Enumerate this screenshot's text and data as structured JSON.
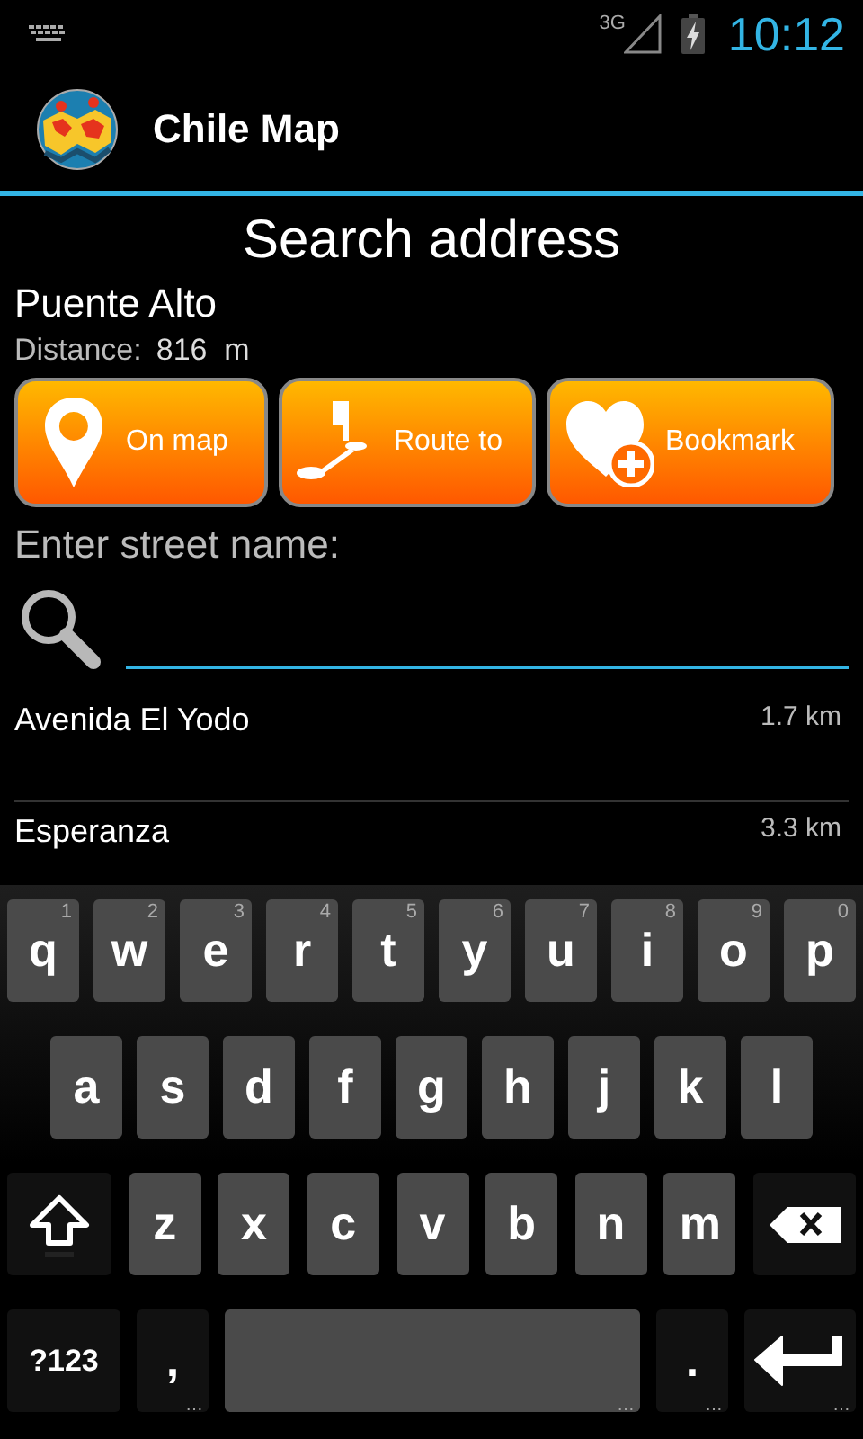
{
  "status_bar": {
    "network": "3G",
    "time": "10:12"
  },
  "app_bar": {
    "title": "Chile Map"
  },
  "heading": "Search address",
  "place": {
    "name": "Puente Alto",
    "distance_label": "Distance:",
    "distance_value": "816  m"
  },
  "actions": [
    {
      "label": "On map",
      "kind": "pin"
    },
    {
      "label": "Route to",
      "kind": "route"
    },
    {
      "label": "Bookmark",
      "kind": "bookmark"
    }
  ],
  "street_label": "Enter street name:",
  "results": [
    {
      "name": "Avenida El Yodo",
      "distance": "1.7 km"
    },
    {
      "name": "Esperanza",
      "distance": "3.3 km"
    }
  ],
  "keyboard": [
    [
      {
        "kind": "letter",
        "label": "q",
        "hint": "1"
      },
      {
        "kind": "letter",
        "label": "w",
        "hint": "2"
      },
      {
        "kind": "letter",
        "label": "e",
        "hint": "3"
      },
      {
        "kind": "letter",
        "label": "r",
        "hint": "4"
      },
      {
        "kind": "letter",
        "label": "t",
        "hint": "5"
      },
      {
        "kind": "letter",
        "label": "y",
        "hint": "6"
      },
      {
        "kind": "letter",
        "label": "u",
        "hint": "7"
      },
      {
        "kind": "letter",
        "label": "i",
        "hint": "8"
      },
      {
        "kind": "letter",
        "label": "o",
        "hint": "9"
      },
      {
        "kind": "letter",
        "label": "p",
        "hint": "0"
      }
    ],
    [
      {
        "kind": "letter",
        "label": "a"
      },
      {
        "kind": "letter",
        "label": "s"
      },
      {
        "kind": "letter",
        "label": "d"
      },
      {
        "kind": "letter",
        "label": "f"
      },
      {
        "kind": "letter",
        "label": "g"
      },
      {
        "kind": "letter",
        "label": "h"
      },
      {
        "kind": "letter",
        "label": "j"
      },
      {
        "kind": "letter",
        "label": "k"
      },
      {
        "kind": "letter",
        "label": "l"
      }
    ],
    [
      {
        "kind": "shift"
      },
      {
        "kind": "letter",
        "label": "z"
      },
      {
        "kind": "letter",
        "label": "x"
      },
      {
        "kind": "letter",
        "label": "c"
      },
      {
        "kind": "letter",
        "label": "v"
      },
      {
        "kind": "letter",
        "label": "b"
      },
      {
        "kind": "letter",
        "label": "n"
      },
      {
        "kind": "letter",
        "label": "m"
      },
      {
        "kind": "delete"
      }
    ],
    [
      {
        "kind": "symbols",
        "label": "?123"
      },
      {
        "kind": "dark",
        "label": ",",
        "more": "…"
      },
      {
        "kind": "space",
        "more": "…"
      },
      {
        "kind": "dark",
        "label": ".",
        "more": "…"
      },
      {
        "kind": "enter",
        "more": "…"
      }
    ]
  ]
}
